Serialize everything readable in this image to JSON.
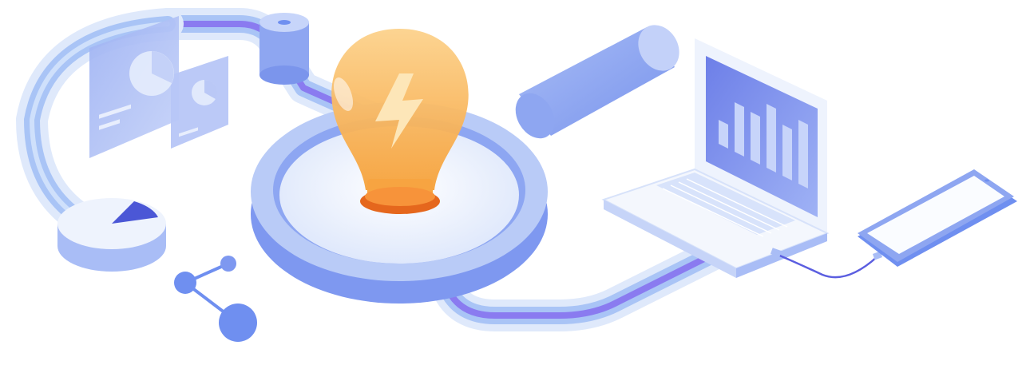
{
  "colors": {
    "background": "#ffffff",
    "pipe_outer": "#dfe9fb",
    "pipe_mid": "#a9c4f6",
    "pipe_core": "#8a7bf0",
    "primary_blue": "#6f8ff0",
    "light_blue": "#b9cbf7",
    "pale_blue": "#eef3fd",
    "accent_purple": "#5b5ee0",
    "bulb_orange": "#f7a441",
    "bulb_glow": "#fcd79b",
    "bulb_base": "#f0731f",
    "laptop_body": "#f4f7fd",
    "laptop_screen": "#7c8ff0",
    "phone_body": "#7f95ee",
    "phone_screen": "#fafcff"
  },
  "icons": [
    "pipe-flow-icon",
    "dashboard-panel-icon",
    "pie-chart-icon",
    "cylinder-icon",
    "magnifying-glass-icon",
    "light-bulb-icon",
    "lightning-bolt-icon",
    "laptop-icon",
    "bar-chart-icon",
    "keyboard-icon",
    "smartphone-icon",
    "cable-icon",
    "share-nodes-icon"
  ]
}
